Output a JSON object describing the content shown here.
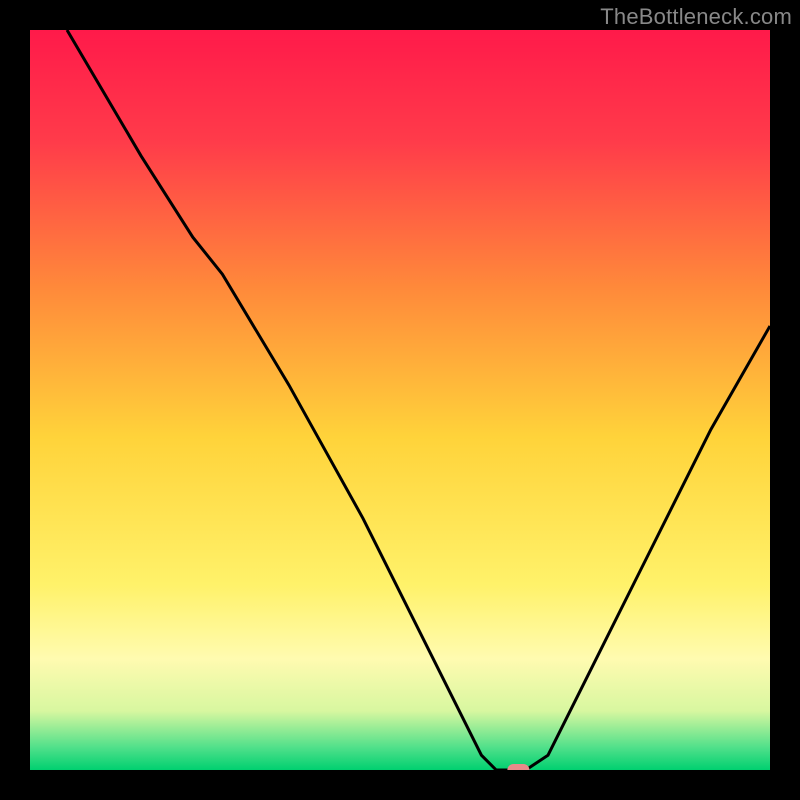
{
  "watermark": "TheBottleneck.com",
  "chart_data": {
    "type": "line",
    "title": "",
    "xlabel": "",
    "ylabel": "",
    "xlim": [
      0,
      100
    ],
    "ylim": [
      0,
      100
    ],
    "background": {
      "type": "vertical-gradient",
      "stops": [
        {
          "offset": 0.0,
          "color": "#ff1a4a"
        },
        {
          "offset": 0.15,
          "color": "#ff3b4a"
        },
        {
          "offset": 0.35,
          "color": "#ff8a3a"
        },
        {
          "offset": 0.55,
          "color": "#ffd33a"
        },
        {
          "offset": 0.75,
          "color": "#fff26a"
        },
        {
          "offset": 0.85,
          "color": "#fffbb0"
        },
        {
          "offset": 0.92,
          "color": "#d8f7a0"
        },
        {
          "offset": 0.97,
          "color": "#4fe08a"
        },
        {
          "offset": 1.0,
          "color": "#00d070"
        }
      ]
    },
    "series": [
      {
        "name": "bottleneck-curve",
        "color": "#000000",
        "width": 2,
        "points": [
          {
            "x": 5,
            "y": 100
          },
          {
            "x": 15,
            "y": 83
          },
          {
            "x": 22,
            "y": 72
          },
          {
            "x": 26,
            "y": 67
          },
          {
            "x": 35,
            "y": 52
          },
          {
            "x": 45,
            "y": 34
          },
          {
            "x": 53,
            "y": 18
          },
          {
            "x": 58,
            "y": 8
          },
          {
            "x": 61,
            "y": 2
          },
          {
            "x": 63,
            "y": 0
          },
          {
            "x": 67,
            "y": 0
          },
          {
            "x": 70,
            "y": 2
          },
          {
            "x": 76,
            "y": 14
          },
          {
            "x": 84,
            "y": 30
          },
          {
            "x": 92,
            "y": 46
          },
          {
            "x": 100,
            "y": 60
          }
        ]
      }
    ],
    "marker": {
      "name": "optimal-point",
      "x": 66,
      "y": 0,
      "color": "#e88a8a",
      "shape": "capsule"
    }
  }
}
